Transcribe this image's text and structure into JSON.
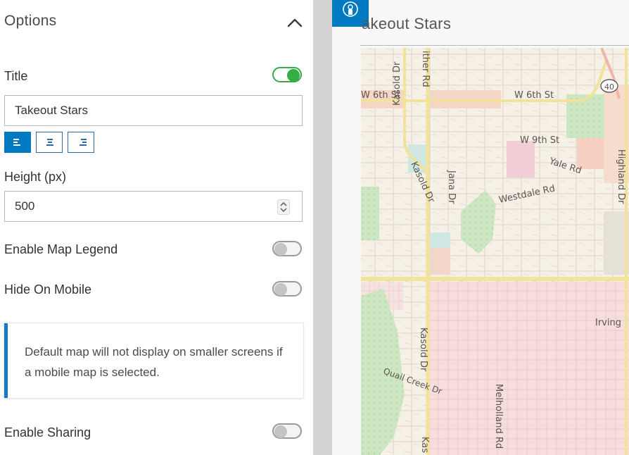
{
  "panel": {
    "header": {
      "title": "Options"
    },
    "title_field": {
      "label": "Title",
      "value": "Takeout Stars",
      "toggle_on": true
    },
    "alignment": {
      "selected": "left",
      "options": [
        "left",
        "center",
        "right"
      ]
    },
    "height_field": {
      "label": "Height (px)",
      "value": "500"
    },
    "enable_map_legend": {
      "label": "Enable Map Legend",
      "toggle_on": false
    },
    "hide_on_mobile": {
      "label": "Hide On Mobile",
      "toggle_on": false
    },
    "notice": {
      "text": "Default map will not display on smaller screens if a mobile map is selected."
    },
    "enable_sharing": {
      "label": "Enable Sharing",
      "toggle_on": false
    }
  },
  "preview": {
    "title_visible": "akeout Stars",
    "map": {
      "streets": [
        "W 6th St",
        "W 6th St",
        "W 9th St",
        "Yale Rd",
        "Westdale Rd",
        "Kasold Dr",
        "Kasold Dr",
        "Kasold Dr",
        "Kas",
        "Jana Dr",
        "ither Rd",
        "Quail Creek Dr",
        "Melholland Rd",
        "Highland Dr",
        "Irving"
      ],
      "route_shield": "40"
    }
  },
  "colors": {
    "accent_blue": "#0079c1",
    "toggle_on": "#35ac46",
    "notice_border": "#1878c3",
    "gutter": "#d3d3d3"
  }
}
